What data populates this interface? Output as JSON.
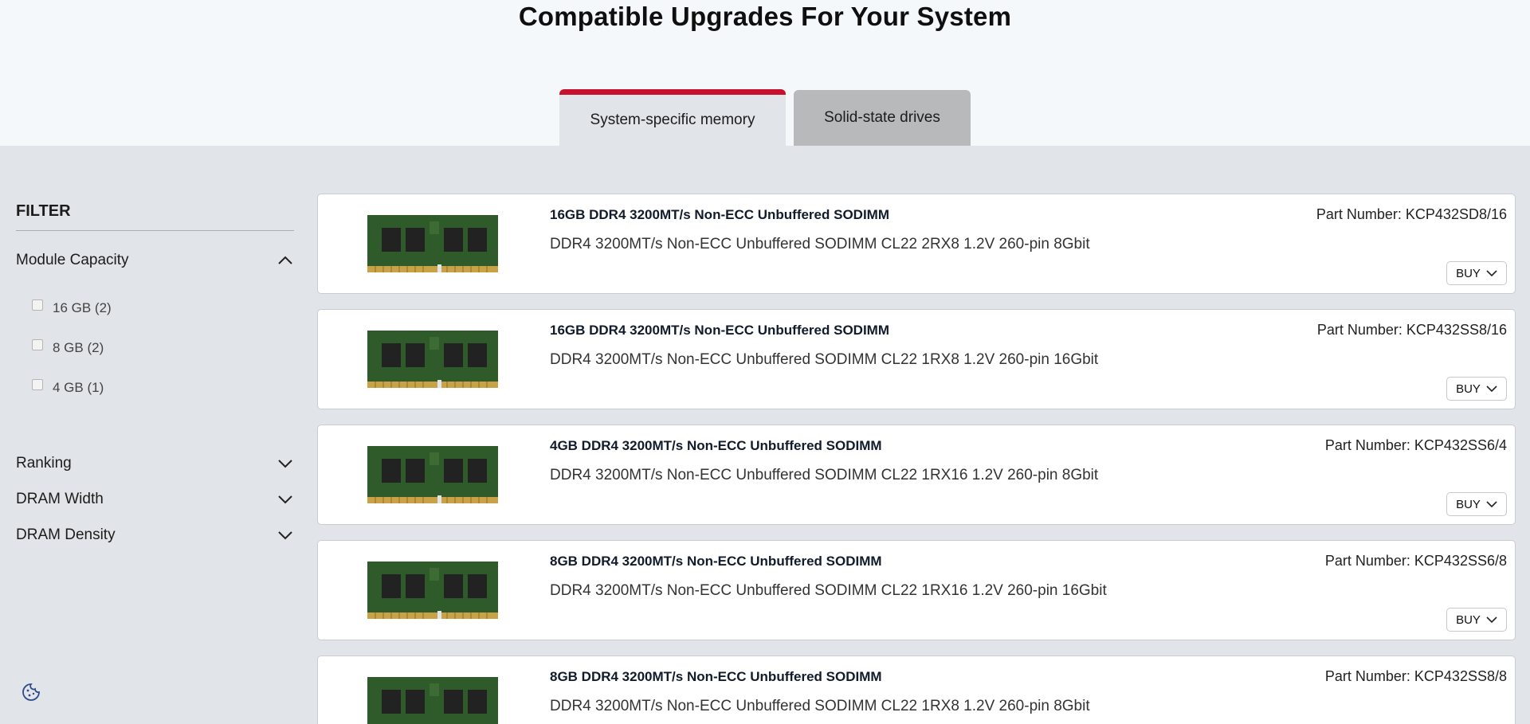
{
  "page": {
    "title": "Compatible Upgrades For Your System"
  },
  "tabs": [
    {
      "label": "System-specific memory",
      "active": true
    },
    {
      "label": "Solid-state drives",
      "active": false
    }
  ],
  "filter": {
    "title": "FILTER",
    "sections": [
      {
        "label": "Module Capacity",
        "expanded": true,
        "icon": "chevron-up-icon"
      },
      {
        "label": "Ranking",
        "expanded": false,
        "icon": "chevron-down-icon"
      },
      {
        "label": "DRAM Width",
        "expanded": false,
        "icon": "chevron-down-icon"
      },
      {
        "label": "DRAM Density",
        "expanded": false,
        "icon": "chevron-down-icon"
      }
    ],
    "capacity_options": [
      {
        "label": "16 GB (2)",
        "checked": false
      },
      {
        "label": "8 GB (2)",
        "checked": false
      },
      {
        "label": "4 GB (1)",
        "checked": false
      }
    ]
  },
  "products": [
    {
      "name": "16GB DDR4 3200MT/s Non-ECC Unbuffered SODIMM",
      "desc": "DDR4 3200MT/s Non-ECC Unbuffered SODIMM CL22 2RX8 1.2V 260-pin 8Gbit",
      "part": "Part Number: KCP432SD8/16",
      "buy": "BUY"
    },
    {
      "name": "16GB DDR4 3200MT/s Non-ECC Unbuffered SODIMM",
      "desc": "DDR4 3200MT/s Non-ECC Unbuffered SODIMM CL22 1RX8 1.2V 260-pin 16Gbit",
      "part": "Part Number: KCP432SS8/16",
      "buy": "BUY"
    },
    {
      "name": "4GB DDR4 3200MT/s Non-ECC Unbuffered SODIMM",
      "desc": "DDR4 3200MT/s Non-ECC Unbuffered SODIMM CL22 1RX16 1.2V 260-pin 8Gbit",
      "part": "Part Number: KCP432SS6/4",
      "buy": "BUY"
    },
    {
      "name": "8GB DDR4 3200MT/s Non-ECC Unbuffered SODIMM",
      "desc": "DDR4 3200MT/s Non-ECC Unbuffered SODIMM CL22 1RX16 1.2V 260-pin 16Gbit",
      "part": "Part Number: KCP432SS6/8",
      "buy": "BUY"
    },
    {
      "name": "8GB DDR4 3200MT/s Non-ECC Unbuffered SODIMM",
      "desc": "DDR4 3200MT/s Non-ECC Unbuffered SODIMM CL22 1RX8 1.2V 260-pin 8Gbit",
      "part": "Part Number: KCP432SS8/8",
      "buy": "BUY"
    }
  ],
  "colors": {
    "accent": "#c8102e",
    "background": "#e1e4e8",
    "header_bg": "#f5f8fb",
    "inactive_tab": "#b7b9bb"
  },
  "icons": {
    "cookie": "cookie-icon",
    "buy_chevron": "chevron-down-icon"
  }
}
